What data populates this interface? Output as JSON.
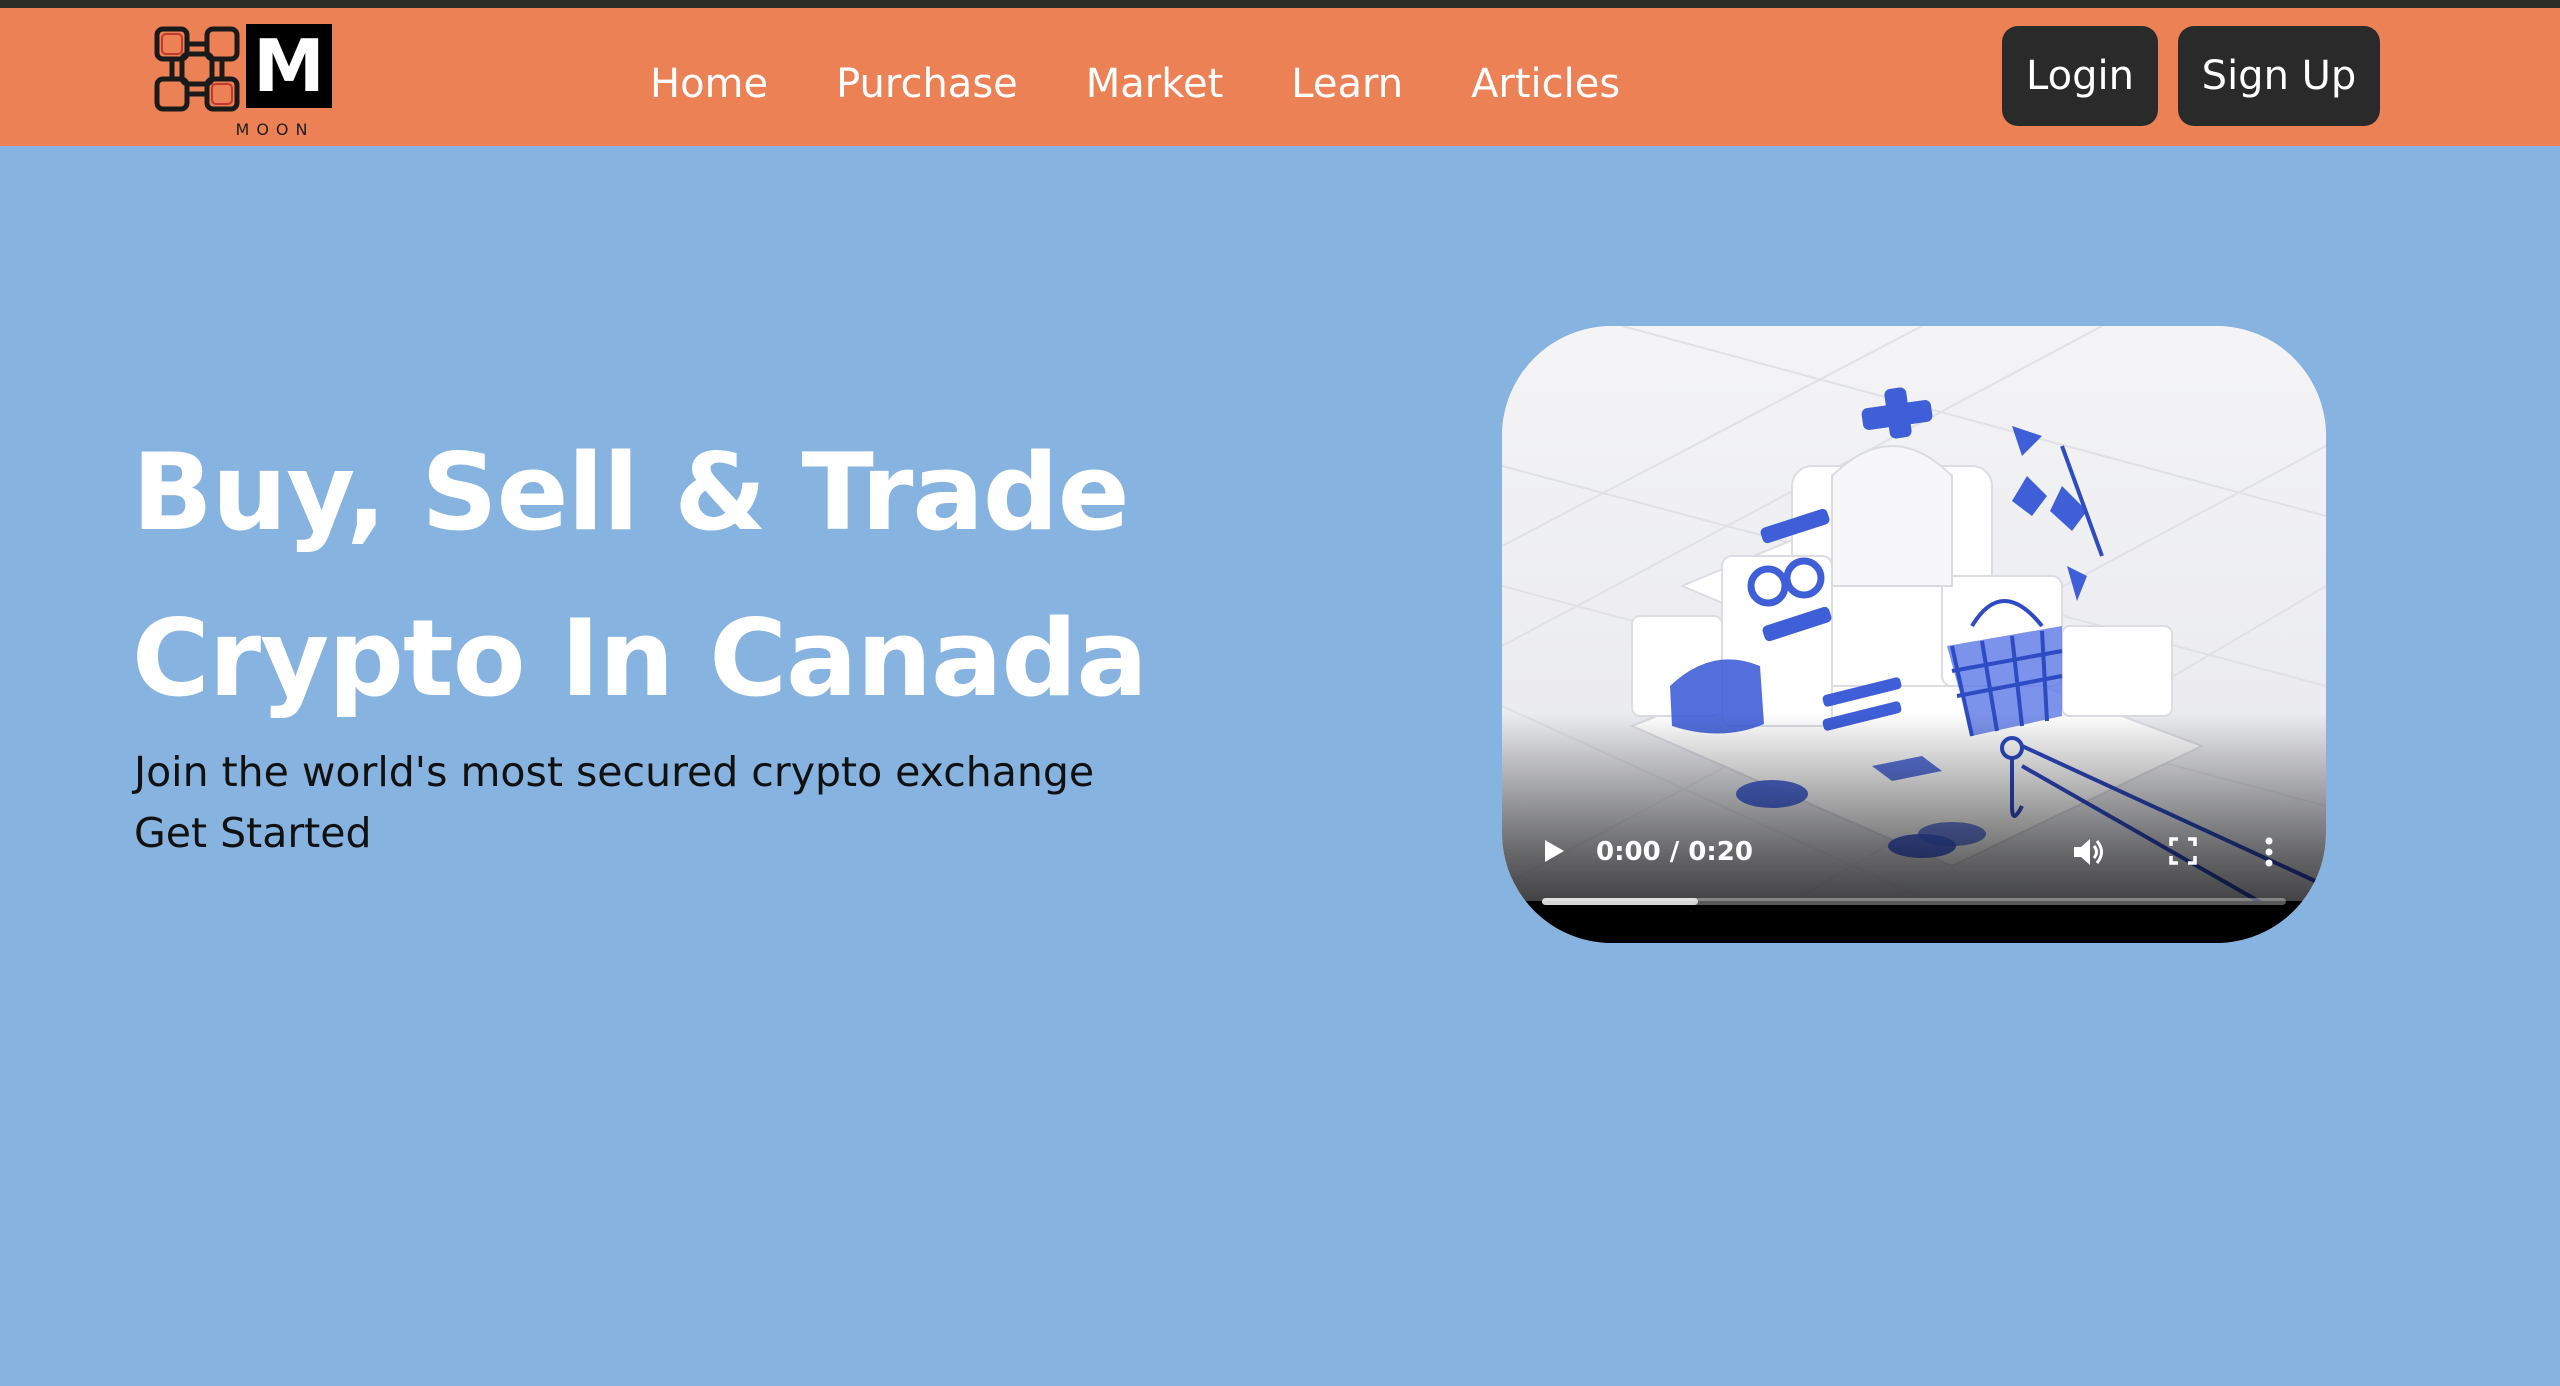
{
  "brand": {
    "name": "MOON",
    "letter": "M"
  },
  "nav": {
    "items": [
      {
        "label": "Home"
      },
      {
        "label": "Purchase"
      },
      {
        "label": "Market"
      },
      {
        "label": "Learn"
      },
      {
        "label": "Articles"
      }
    ]
  },
  "auth": {
    "login_label": "Login",
    "signup_label": "Sign Up"
  },
  "hero": {
    "title_line1": "Buy, Sell & Trade",
    "title_line2": "Crypto In Canada",
    "subtitle": "Join the world's most secured crypto exchange",
    "cta_label": "Get Started"
  },
  "video": {
    "time_display": "0:00 / 0:20",
    "buffered_fraction": 0.21,
    "icons": [
      "play-icon",
      "volume-icon",
      "fullscreen-icon",
      "more-options-icon"
    ]
  },
  "colors": {
    "header_bg": "#ec8155",
    "page_bg": "#87b3e1",
    "button_bg": "#2a2a2a",
    "top_strip": "#2b2e26",
    "scene_accent": "#3f5fd8"
  }
}
